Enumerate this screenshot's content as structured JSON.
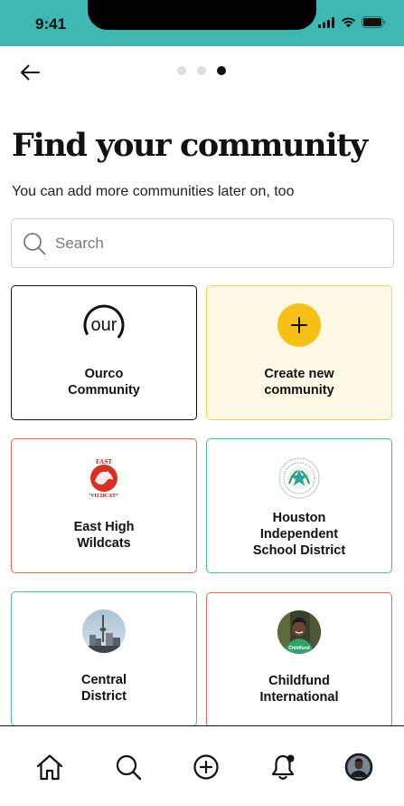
{
  "status_bar": {
    "time": "9:41"
  },
  "header": {
    "pager_dots": 3,
    "active_dot": 3
  },
  "page": {
    "title": "Find your community",
    "subtitle": "You can add more communities later on, too"
  },
  "search": {
    "placeholder": "Search",
    "value": ""
  },
  "cards": [
    {
      "label": "Ourco\nCommunity",
      "logo_text": "our",
      "border_color": "#111111"
    },
    {
      "label": "Create new\ncommunity",
      "border_color": "#f2d45a",
      "background": "#fdf8e3",
      "accent": "#f6c117"
    },
    {
      "label": "East High\nWildcats",
      "logo_text_top": "EAST",
      "logo_text_bottom": "WILDCATS",
      "border_color": "#e8694f"
    },
    {
      "label": "Houston\nIndependent\nSchool District",
      "border_color": "#47b9b4"
    },
    {
      "label": "Central\nDistrict",
      "border_color": "#47b9b4"
    },
    {
      "label": "Childfund\nInternational",
      "logo_text": "Childfund",
      "border_color": "#e8694f"
    }
  ],
  "bottom_nav": [
    {
      "icon": "home-icon"
    },
    {
      "icon": "search-icon"
    },
    {
      "icon": "add-circle-icon"
    },
    {
      "icon": "notification-bell-icon"
    },
    {
      "icon": "profile-avatar-icon"
    }
  ],
  "colors": {
    "status_bar_bg": "#3fb7b3",
    "accent_yellow": "#f6c117",
    "coral": "#e8694f",
    "teal": "#47b9b4"
  }
}
